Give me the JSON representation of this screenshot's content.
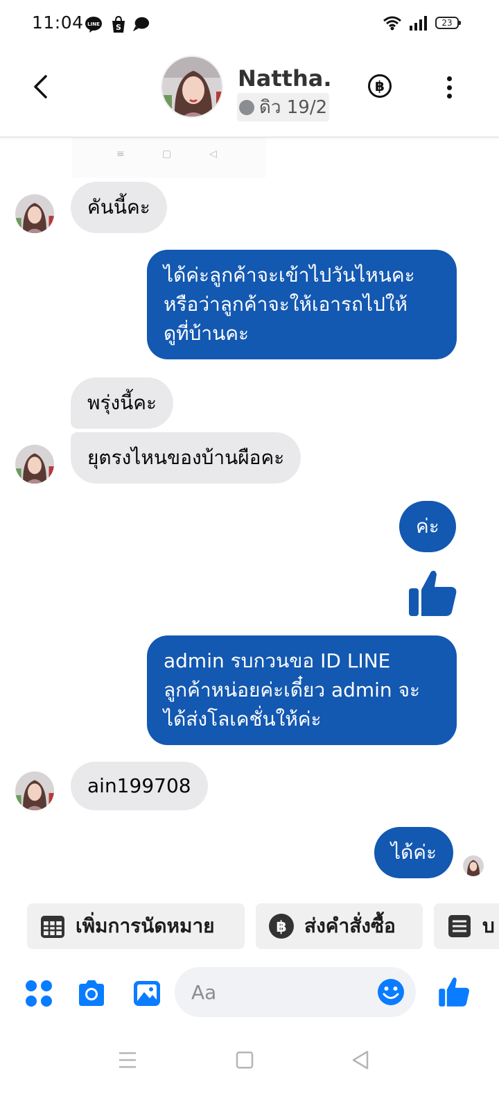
{
  "status_bar": {
    "time": "11:04",
    "battery": "23",
    "app_icons": [
      "line-icon",
      "shopee-icon",
      "chat-bubble-icon"
    ],
    "right_icons": [
      "wifi-icon",
      "signal-icon",
      "battery-icon"
    ]
  },
  "header": {
    "contact_name": "Nattha...",
    "contact_status": "ดิว 19/2",
    "icons": [
      "back-arrow-icon",
      "baht-icon",
      "more-vertical-icon"
    ]
  },
  "messages": [
    {
      "direction": "in",
      "text": "คันนี้คะ"
    },
    {
      "direction": "out",
      "lines": [
        "ได้ค่ะลูกค้าจะเข้าไปวันไหนคะ",
        "หรือว่าลูกค้าจะให้เอารถไปให้",
        "ดูที่บ้านคะ"
      ]
    },
    {
      "direction": "in",
      "text": "พรุ่งนี้คะ"
    },
    {
      "direction": "in",
      "text": "ยุตรงไหนของบ้านผือคะ"
    },
    {
      "direction": "out",
      "text": "ค่ะ"
    },
    {
      "direction": "out",
      "lines": [
        "admin รบกวนขอ ID LINE",
        "ลูกค้าหน่อยค่ะเดี๋ยว admin จะ",
        "ได้ส่งโลเคชั่นให้ค่ะ"
      ]
    },
    {
      "direction": "in",
      "text": "ain199708"
    },
    {
      "direction": "out",
      "text": "ได้ค่ะ"
    }
  ],
  "quick_replies": [
    {
      "label": "เพิ่มการนัดหมาย",
      "icon": "calendar-icon"
    },
    {
      "label": "ส่งคำสั่งซื้อ",
      "icon": "baht-icon"
    },
    {
      "label": "บ",
      "icon": "invoice-icon"
    }
  ],
  "composer": {
    "placeholder": "Aa",
    "icons": [
      "menu-dots-icon",
      "camera-icon",
      "gallery-icon",
      "emoji-icon",
      "thumbs-up-icon"
    ]
  },
  "colors": {
    "outgoing_bubble": "#1358b1",
    "incoming_bubble": "#e9e9eb",
    "accent": "#0a7cff"
  },
  "system_nav": [
    "menu-icon",
    "home-icon",
    "back-icon"
  ]
}
